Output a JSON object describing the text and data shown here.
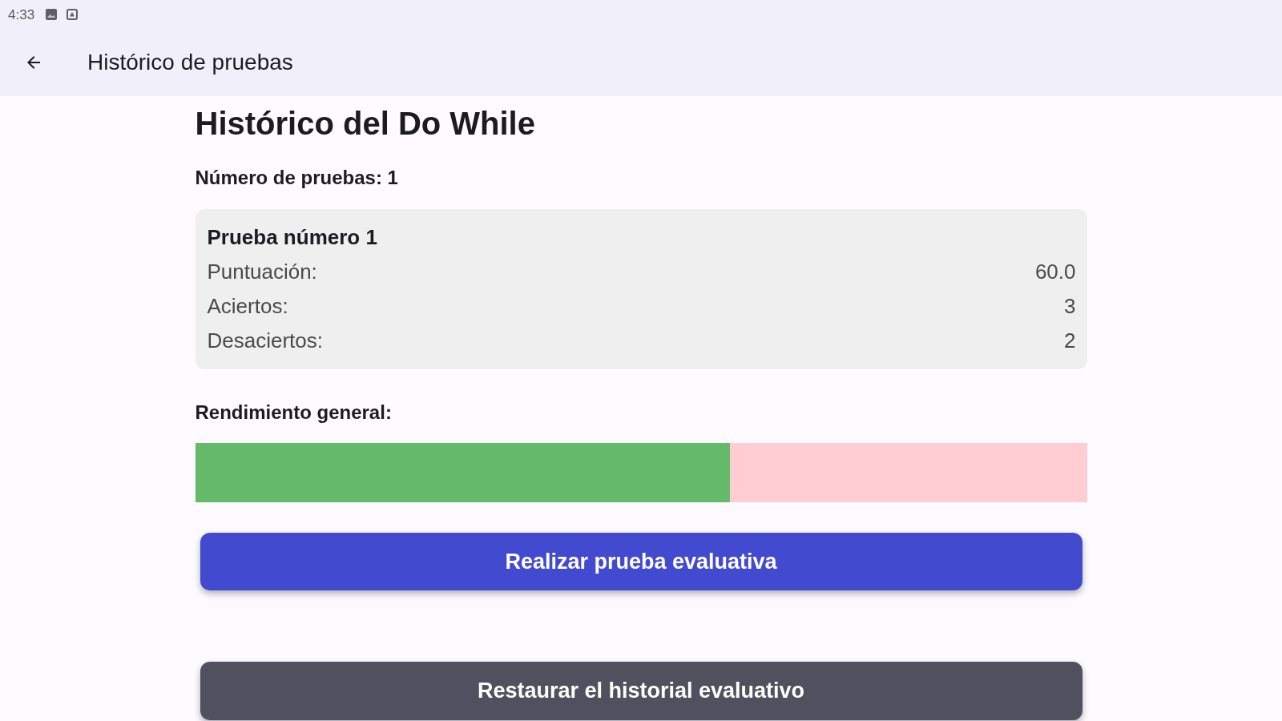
{
  "status_bar": {
    "time": "4:33"
  },
  "app_bar": {
    "title": "Histórico de pruebas"
  },
  "heading": "Histórico del Do While",
  "count_label": "Número de pruebas: 1",
  "tests": [
    {
      "title": "Prueba número 1",
      "fields": [
        {
          "label": "Puntuación:",
          "value": "60.0"
        },
        {
          "label": "Aciertos:",
          "value": "3"
        },
        {
          "label": "Desaciertos:",
          "value": "2"
        }
      ]
    }
  ],
  "performance": {
    "label": "Rendimiento general:",
    "level": 0.6
  },
  "buttons": [
    {
      "label": "Realizar prueba evaluativa",
      "kind": "primary"
    },
    {
      "label": "Restaurar el historial evaluativo",
      "kind": "secondary"
    }
  ]
}
